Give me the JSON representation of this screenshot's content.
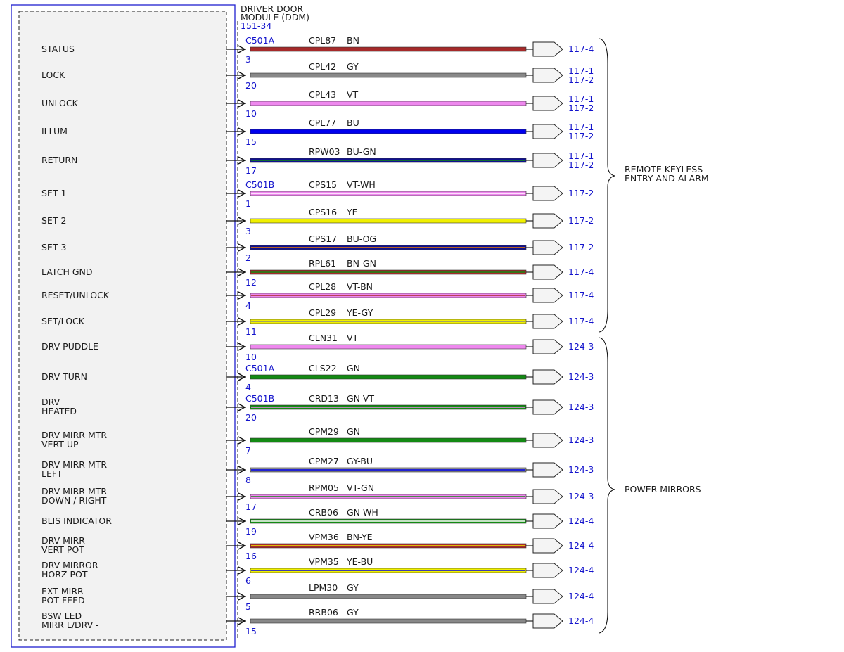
{
  "module": {
    "name_line1": "DRIVER DOOR",
    "name_line2": "MODULE (DDM)",
    "ref": "151-34"
  },
  "colors": {
    "frame_blue": "#2020d0",
    "link_blue": "#1414cc",
    "BN": "#a52a2a",
    "GY": "#888888",
    "VT": "#ee88ee",
    "BU": "#0000ee",
    "GN": "#138a13",
    "YE": "#f0f000",
    "WH": "#ffffff",
    "OG": "#f08000",
    "NAVY": "#101090"
  },
  "groups": [
    {
      "label_line1": "REMOTE KEYLESS",
      "label_line2": "ENTRY AND ALARM"
    },
    {
      "label_line1": "POWER MIRRORS",
      "label_line2": ""
    }
  ],
  "wires": [
    {
      "label": [
        "STATUS"
      ],
      "connector": "C501A",
      "pin": "3",
      "circuit": "CPL87",
      "color": "BN",
      "refs": [
        "117-4"
      ]
    },
    {
      "label": [
        "LOCK"
      ],
      "connector": "",
      "pin": "20",
      "circuit": "CPL42",
      "color": "GY",
      "refs": [
        "117-1",
        "117-2"
      ]
    },
    {
      "label": [
        "UNLOCK"
      ],
      "connector": "",
      "pin": "10",
      "circuit": "CPL43",
      "color": "VT",
      "refs": [
        "117-1",
        "117-2"
      ]
    },
    {
      "label": [
        "ILLUM"
      ],
      "connector": "",
      "pin": "15",
      "circuit": "CPL77",
      "color": "BU",
      "refs": [
        "117-1",
        "117-2"
      ]
    },
    {
      "label": [
        "RETURN"
      ],
      "connector": "",
      "pin": "17",
      "circuit": "RPW03",
      "color": "BU-GN",
      "refs": [
        "117-1",
        "117-2"
      ]
    },
    {
      "label": [
        "SET 1"
      ],
      "connector": "C501B",
      "pin": "1",
      "circuit": "CPS15",
      "color": "VT-WH",
      "refs": [
        "117-2"
      ]
    },
    {
      "label": [
        "SET 2"
      ],
      "connector": "",
      "pin": "3",
      "circuit": "CPS16",
      "color": "YE",
      "refs": [
        "117-2"
      ]
    },
    {
      "label": [
        "SET 3"
      ],
      "connector": "",
      "pin": "2",
      "circuit": "CPS17",
      "color": "BU-OG",
      "refs": [
        "117-2"
      ]
    },
    {
      "label": [
        "LATCH GND"
      ],
      "connector": "",
      "pin": "12",
      "circuit": "RPL61",
      "color": "BN-GN",
      "refs": [
        "117-4"
      ]
    },
    {
      "label": [
        "RESET/UNLOCK"
      ],
      "connector": "",
      "pin": "4",
      "circuit": "CPL28",
      "color": "VT-BN",
      "refs": [
        "117-4"
      ]
    },
    {
      "label": [
        "SET/LOCK"
      ],
      "connector": "",
      "pin": "11",
      "circuit": "CPL29",
      "color": "YE-GY",
      "refs": [
        "117-4"
      ]
    },
    {
      "label": [
        "DRV PUDDLE"
      ],
      "connector": "",
      "pin": "10",
      "circuit": "CLN31",
      "color": "VT",
      "refs": [
        "124-3"
      ]
    },
    {
      "label": [
        "DRV TURN"
      ],
      "connector": "C501A",
      "pin": "4",
      "circuit": "CLS22",
      "color": "GN",
      "refs": [
        "124-3"
      ]
    },
    {
      "label": [
        "DRV",
        "HEATED"
      ],
      "connector": "C501B",
      "pin": "20",
      "circuit": "CRD13",
      "color": "GN-VT",
      "refs": [
        "124-3"
      ]
    },
    {
      "label": [
        "DRV MIRR MTR",
        "VERT UP"
      ],
      "connector": "",
      "pin": "7",
      "circuit": "CPM29",
      "color": "GN",
      "refs": [
        "124-3"
      ]
    },
    {
      "label": [
        "DRV MIRR MTR",
        "LEFT"
      ],
      "connector": "",
      "pin": "8",
      "circuit": "CPM27",
      "color": "GY-BU",
      "refs": [
        "124-3"
      ]
    },
    {
      "label": [
        "DRV MIRR MTR",
        "DOWN / RIGHT"
      ],
      "connector": "",
      "pin": "17",
      "circuit": "RPM05",
      "color": "VT-GN",
      "refs": [
        "124-3"
      ]
    },
    {
      "label": [
        "BLIS INDICATOR"
      ],
      "connector": "",
      "pin": "19",
      "circuit": "CRB06",
      "color": "GN-WH",
      "refs": [
        "124-4"
      ]
    },
    {
      "label": [
        "DRV MIRR",
        "VERT POT"
      ],
      "connector": "",
      "pin": "16",
      "circuit": "VPM36",
      "color": "BN-YE",
      "refs": [
        "124-4"
      ]
    },
    {
      "label": [
        "DRV MIRROR",
        "HORZ POT"
      ],
      "connector": "",
      "pin": "6",
      "circuit": "VPM35",
      "color": "YE-BU",
      "refs": [
        "124-4"
      ]
    },
    {
      "label": [
        "EXT MIRR",
        "POT FEED"
      ],
      "connector": "",
      "pin": "5",
      "circuit": "LPM30",
      "color": "GY",
      "refs": [
        "124-4"
      ]
    },
    {
      "label": [
        "BSW LED",
        "MIRR L/DRV -"
      ],
      "connector": "",
      "pin": "15",
      "circuit": "RRB06",
      "color": "GY",
      "refs": [
        "124-4"
      ]
    }
  ]
}
